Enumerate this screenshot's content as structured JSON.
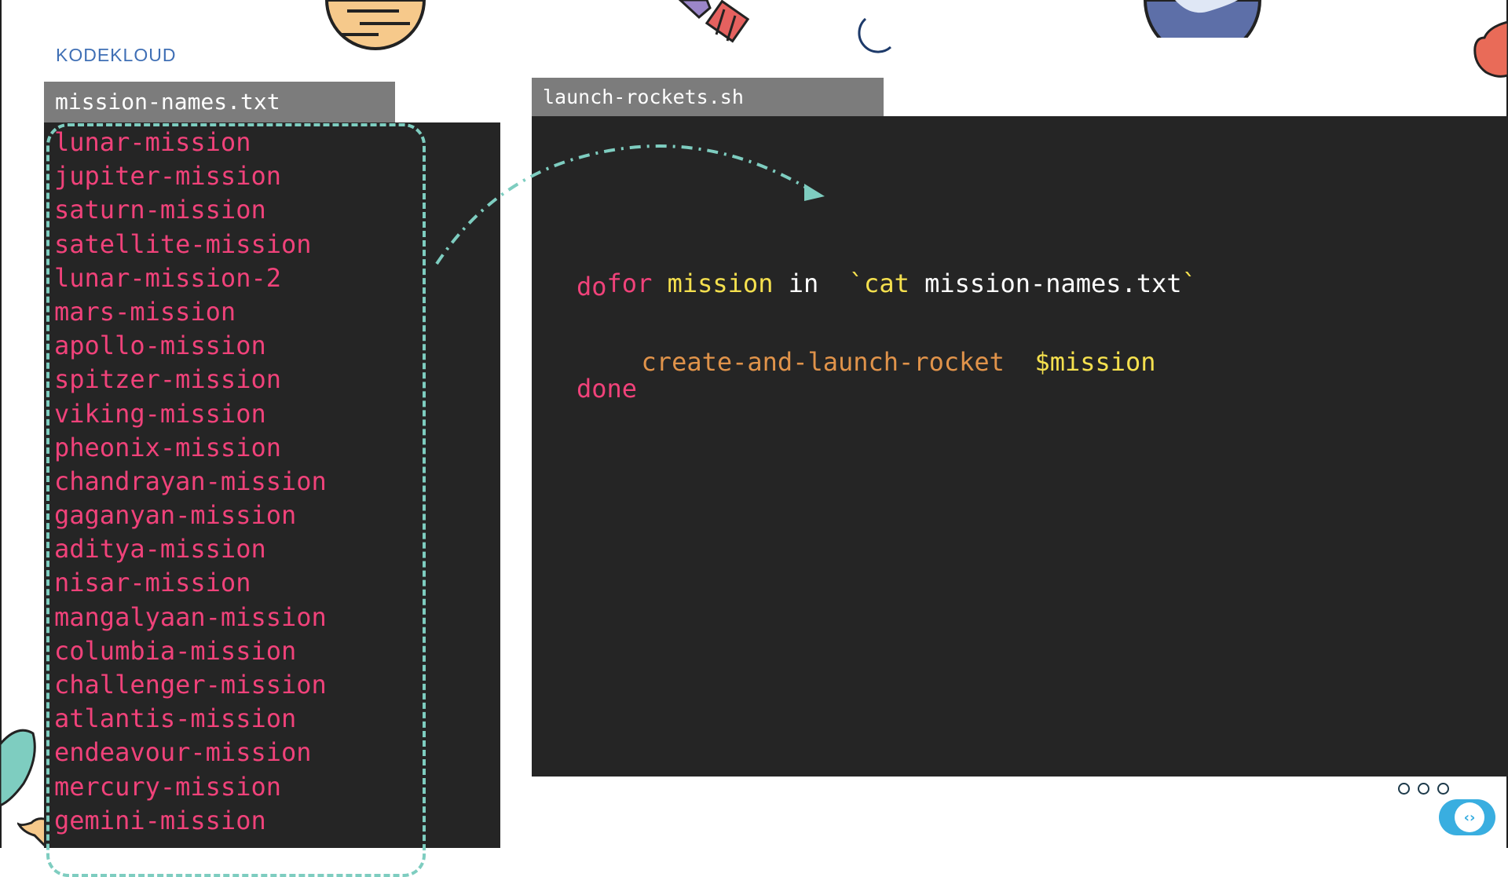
{
  "brand": {
    "logo_text": "KODEKLOUD"
  },
  "file_panel": {
    "tab_label": "mission-names.txt",
    "missions": [
      "lunar-mission",
      "jupiter-mission",
      "saturn-mission",
      "satellite-mission",
      "lunar-mission-2",
      "mars-mission",
      "apollo-mission",
      "spitzer-mission",
      "viking-mission",
      "pheonix-mission",
      "chandrayan-mission",
      "gaganyan-mission",
      "aditya-mission",
      "nisar-mission",
      "mangalyaan-mission",
      "columbia-mission",
      "challenger-mission",
      "atlantis-mission",
      "endeavour-mission",
      "mercury-mission",
      "gemini-mission"
    ]
  },
  "script_panel": {
    "tab_label": "launch-rockets.sh",
    "code": {
      "for_kw": "for",
      "loop_var": "mission",
      "in_kw": "in",
      "backtick_open": "`",
      "cat_cmd": "cat",
      "cat_arg": "mission-names.txt",
      "backtick_close": "`",
      "do_kw": "do",
      "command": "create-and-launch-rocket",
      "arg_var": "$mission",
      "done_kw": "done"
    }
  },
  "colors": {
    "accent_pink": "#f0427a",
    "variable_yellow": "#f5e04e",
    "command_orange": "#e0934a",
    "dash_teal": "#7ecdc0",
    "panel_bg": "#252525",
    "tab_bg": "#7c7c7c"
  },
  "icons": [
    "planet-icon",
    "telescope-icon",
    "moon-icon",
    "globe-icon",
    "rocket-icon",
    "chat-bubble-icon",
    "more-dots-icon"
  ]
}
